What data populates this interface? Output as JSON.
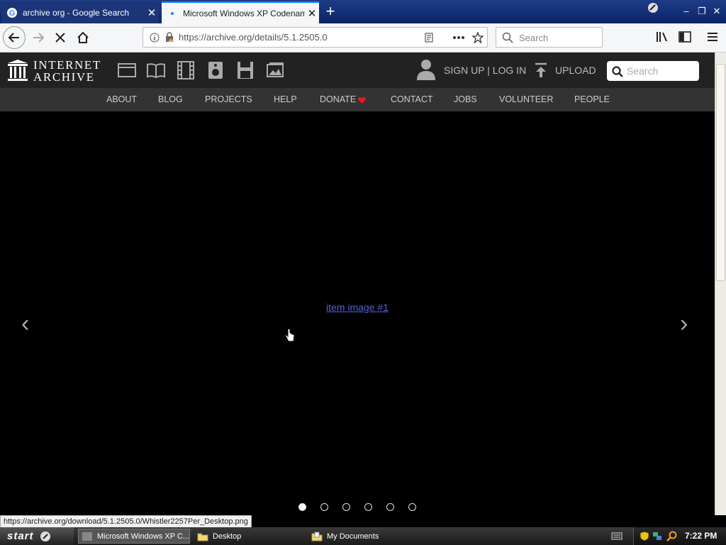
{
  "browser": {
    "tabs": [
      {
        "title": "archive org - Google Search",
        "favicon": "google-g-icon"
      },
      {
        "title": "Microsoft Windows XP Codename",
        "favicon": "loading-dot-icon"
      }
    ],
    "url": "https://archive.org/details/5.1.2505.0",
    "search_placeholder": "Search"
  },
  "ia": {
    "logo_line1": "INTERNET",
    "logo_line2": "ARCHIVE",
    "media_icons": [
      "web-icon",
      "texts-icon",
      "video-icon",
      "audio-icon",
      "software-icon",
      "images-icon"
    ],
    "auth_text": "SIGN UP | LOG IN",
    "upload_text": "UPLOAD",
    "search_placeholder": "Search",
    "nav": [
      "ABOUT",
      "BLOG",
      "PROJECTS",
      "HELP",
      "DONATE",
      "CONTACT",
      "JOBS",
      "VOLUNTEER",
      "PEOPLE"
    ],
    "donate_heart_color": "#e41b17"
  },
  "viewer": {
    "link_text": "item image #1",
    "prev_symbol": "‹",
    "next_symbol": "›",
    "dot_count": 6,
    "active_dot": 0
  },
  "status_url": "https://archive.org/download/5.1.2505.0/Whistler2257Per_Desktop.png",
  "taskbar": {
    "start_label": "start",
    "tasks": [
      "Microsoft Windows XP C...",
      "Desktop",
      "My Documents"
    ],
    "clock": "7:22 PM"
  }
}
